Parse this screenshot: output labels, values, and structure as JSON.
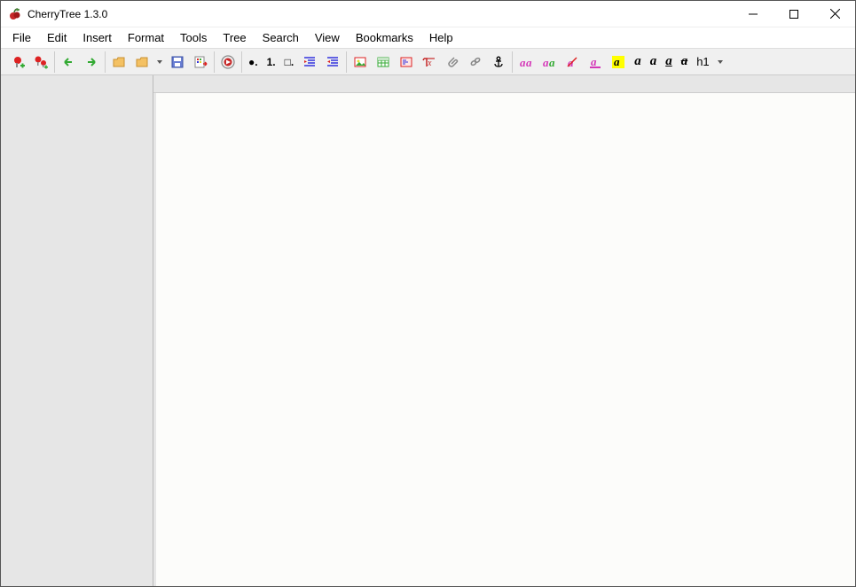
{
  "title": "CherryTree 1.3.0",
  "menu": {
    "file": "File",
    "edit": "Edit",
    "insert": "Insert",
    "format": "Format",
    "tools": "Tools",
    "tree": "Tree",
    "search": "Search",
    "view": "View",
    "bookmarks": "Bookmarks",
    "help": "Help"
  },
  "toolbar": {
    "bullet_glyph": "●.",
    "number_glyph": "1.",
    "check_glyph": "□.",
    "bold_glyph": "a",
    "italic_glyph": "a",
    "underline_glyph": "a",
    "strike_glyph": "a",
    "heading_glyph": "h1"
  }
}
